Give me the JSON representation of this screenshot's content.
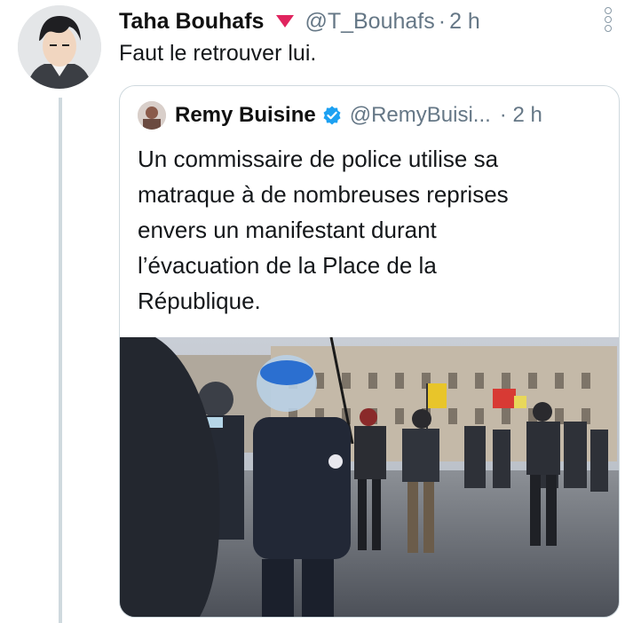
{
  "tweet": {
    "author_name": "Taha Bouhafs",
    "author_handle": "@T_Bouhafs",
    "separator": "·",
    "time": "2 h",
    "text": "Faut le retrouver lui."
  },
  "quoted_tweet": {
    "author_name": "Remy Buisine",
    "author_handle": "@RemyBuisi...",
    "separator": "·",
    "time": "2 h",
    "text_lines": [
      "Un commissaire de police utilise sa",
      "matraque à de nombreuses reprises",
      "envers un manifestant durant",
      "l’évacuation de la Place de la",
      "République."
    ]
  },
  "icons": {
    "badge": "red-down-triangle-icon",
    "verified": "verified-badge-icon",
    "more": "more-options-icon"
  },
  "colors": {
    "accent": "#1da1f2",
    "badge": "#e0245e",
    "secondary_text": "#657786",
    "border": "#cfd9de"
  }
}
